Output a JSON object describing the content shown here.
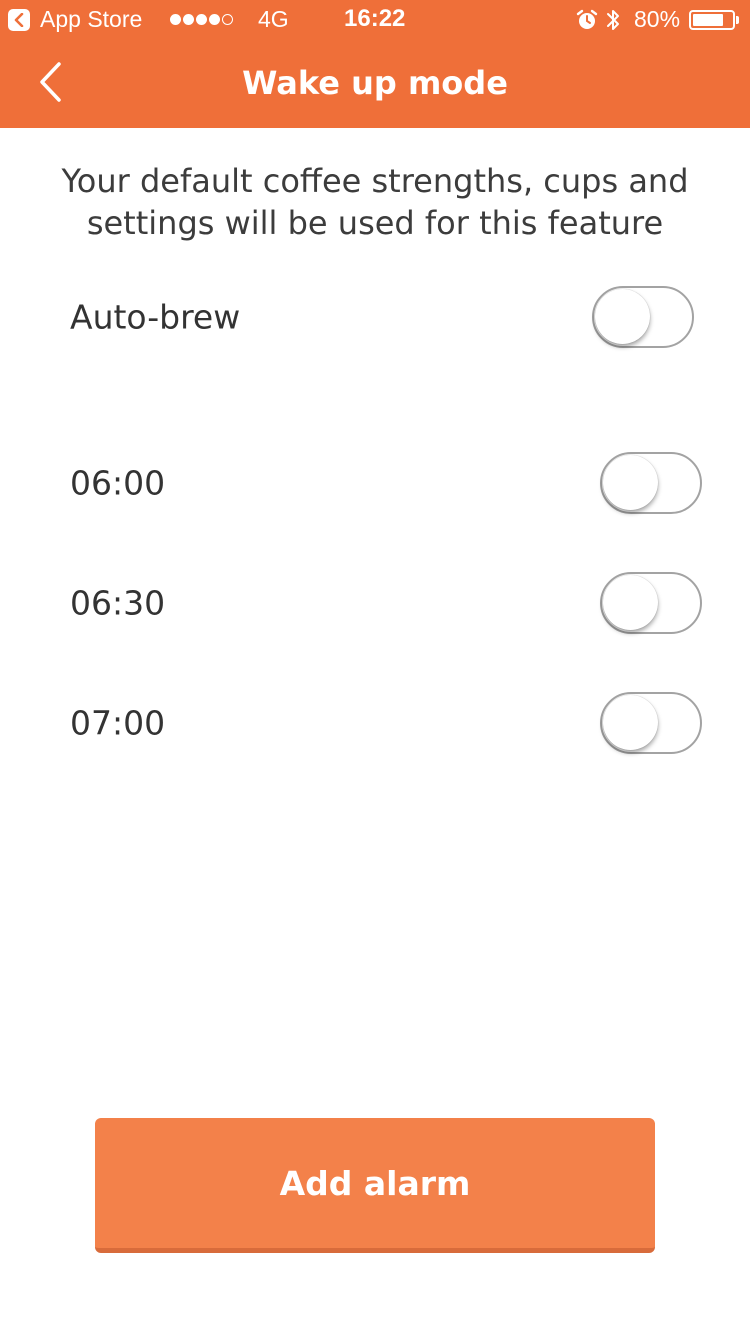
{
  "colors": {
    "header": "#ef6f39",
    "button": "#f3814a",
    "text": "#333333",
    "toggle_border": "#a3a3a3"
  },
  "status_bar": {
    "back_app": "App Store",
    "signal_dots_filled": 4,
    "signal_dots_total": 5,
    "network": "4G",
    "time": "16:22",
    "alarm_icon": "alarm-clock-icon",
    "bluetooth_icon": "bluetooth-icon",
    "battery_percent": "80%",
    "battery_level": 0.8
  },
  "nav": {
    "back_icon": "chevron-left-icon",
    "title": "Wake up mode"
  },
  "intro_text": "Your default coffee strengths, cups and settings will be used for this feature",
  "auto_brew": {
    "label": "Auto-brew",
    "enabled": false
  },
  "alarms": [
    {
      "time": "06:00",
      "enabled": false
    },
    {
      "time": "06:30",
      "enabled": false
    },
    {
      "time": "07:00",
      "enabled": false
    }
  ],
  "add_button_label": "Add alarm"
}
